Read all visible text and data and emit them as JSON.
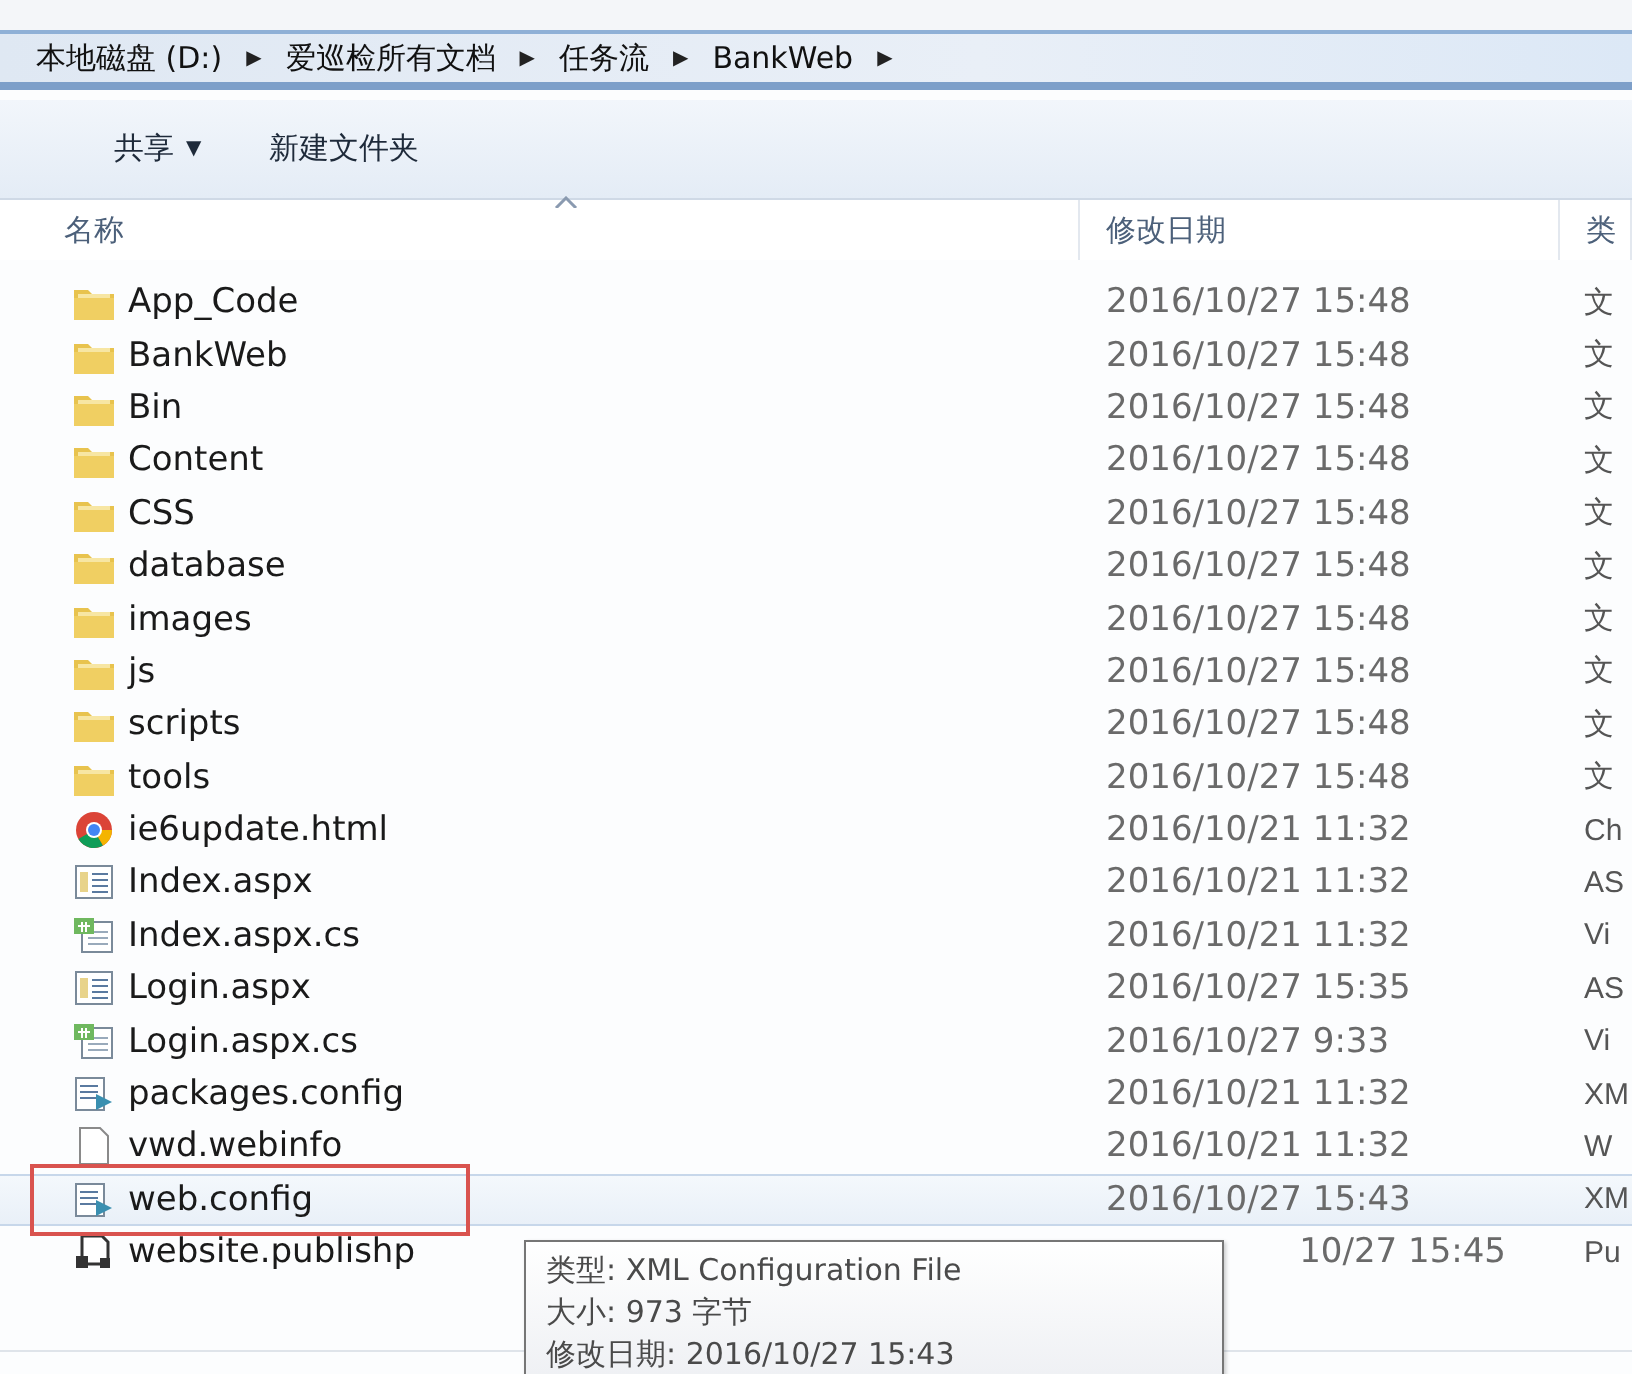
{
  "breadcrumbs": [
    {
      "label": "本地磁盘 (D:)",
      "arrow": "▶"
    },
    {
      "label": "爱巡检所有文档",
      "arrow": "▶"
    },
    {
      "label": "任务流",
      "arrow": "▶"
    },
    {
      "label": "BankWeb",
      "arrow": "▶"
    }
  ],
  "toolbar": {
    "share": "共享",
    "share_caret": "▼",
    "new_folder": "新建文件夹"
  },
  "columns": [
    {
      "label": "名称",
      "sorted": true
    },
    {
      "label": "修改日期",
      "sorted": false
    },
    {
      "label": "类",
      "sorted": false
    }
  ],
  "rows": [
    {
      "kind": "folder",
      "name": "App_Code",
      "date": "2016/10/27 15:48",
      "type": "文",
      "selected": false
    },
    {
      "kind": "folder",
      "name": "BankWeb",
      "date": "2016/10/27 15:48",
      "type": "文",
      "selected": false
    },
    {
      "kind": "folder",
      "name": "Bin",
      "date": "2016/10/27 15:48",
      "type": "文",
      "selected": false
    },
    {
      "kind": "folder",
      "name": "Content",
      "date": "2016/10/27 15:48",
      "type": "文",
      "selected": false
    },
    {
      "kind": "folder",
      "name": "CSS",
      "date": "2016/10/27 15:48",
      "type": "文",
      "selected": false
    },
    {
      "kind": "folder",
      "name": "database",
      "date": "2016/10/27 15:48",
      "type": "文",
      "selected": false
    },
    {
      "kind": "folder",
      "name": "images",
      "date": "2016/10/27 15:48",
      "type": "文",
      "selected": false
    },
    {
      "kind": "folder",
      "name": "js",
      "date": "2016/10/27 15:48",
      "type": "文",
      "selected": false
    },
    {
      "kind": "folder",
      "name": "scripts",
      "date": "2016/10/27 15:48",
      "type": "文",
      "selected": false
    },
    {
      "kind": "folder",
      "name": "tools",
      "date": "2016/10/27 15:48",
      "type": "文",
      "selected": false
    },
    {
      "kind": "html",
      "name": "ie6update.html",
      "date": "2016/10/21 11:32",
      "type": "Ch",
      "selected": false
    },
    {
      "kind": "aspx",
      "name": "Index.aspx",
      "date": "2016/10/21 11:32",
      "type": "AS",
      "selected": false
    },
    {
      "kind": "cs",
      "name": "Index.aspx.cs",
      "date": "2016/10/21 11:32",
      "type": "Vi",
      "selected": false
    },
    {
      "kind": "aspx",
      "name": "Login.aspx",
      "date": "2016/10/27 15:35",
      "type": "AS",
      "selected": false
    },
    {
      "kind": "cs",
      "name": "Login.aspx.cs",
      "date": "2016/10/27 9:33",
      "type": "Vi",
      "selected": false
    },
    {
      "kind": "config",
      "name": "packages.config",
      "date": "2016/10/21 11:32",
      "type": "XM",
      "selected": false
    },
    {
      "kind": "blank",
      "name": "vwd.webinfo",
      "date": "2016/10/21 11:32",
      "type": "W",
      "selected": false
    },
    {
      "kind": "config",
      "name": "web.config",
      "date": "2016/10/27 15:43",
      "type": "XM",
      "selected": true,
      "marked": true
    },
    {
      "kind": "publish",
      "name": "website.publishp",
      "date": "10/27 15:45",
      "type": "Pu",
      "selected": false,
      "covered": true
    }
  ],
  "tooltip": {
    "lines": [
      "类型: XML Configuration File",
      "大小: 973 字节",
      "修改日期: 2016/10/27 15:43"
    ]
  }
}
